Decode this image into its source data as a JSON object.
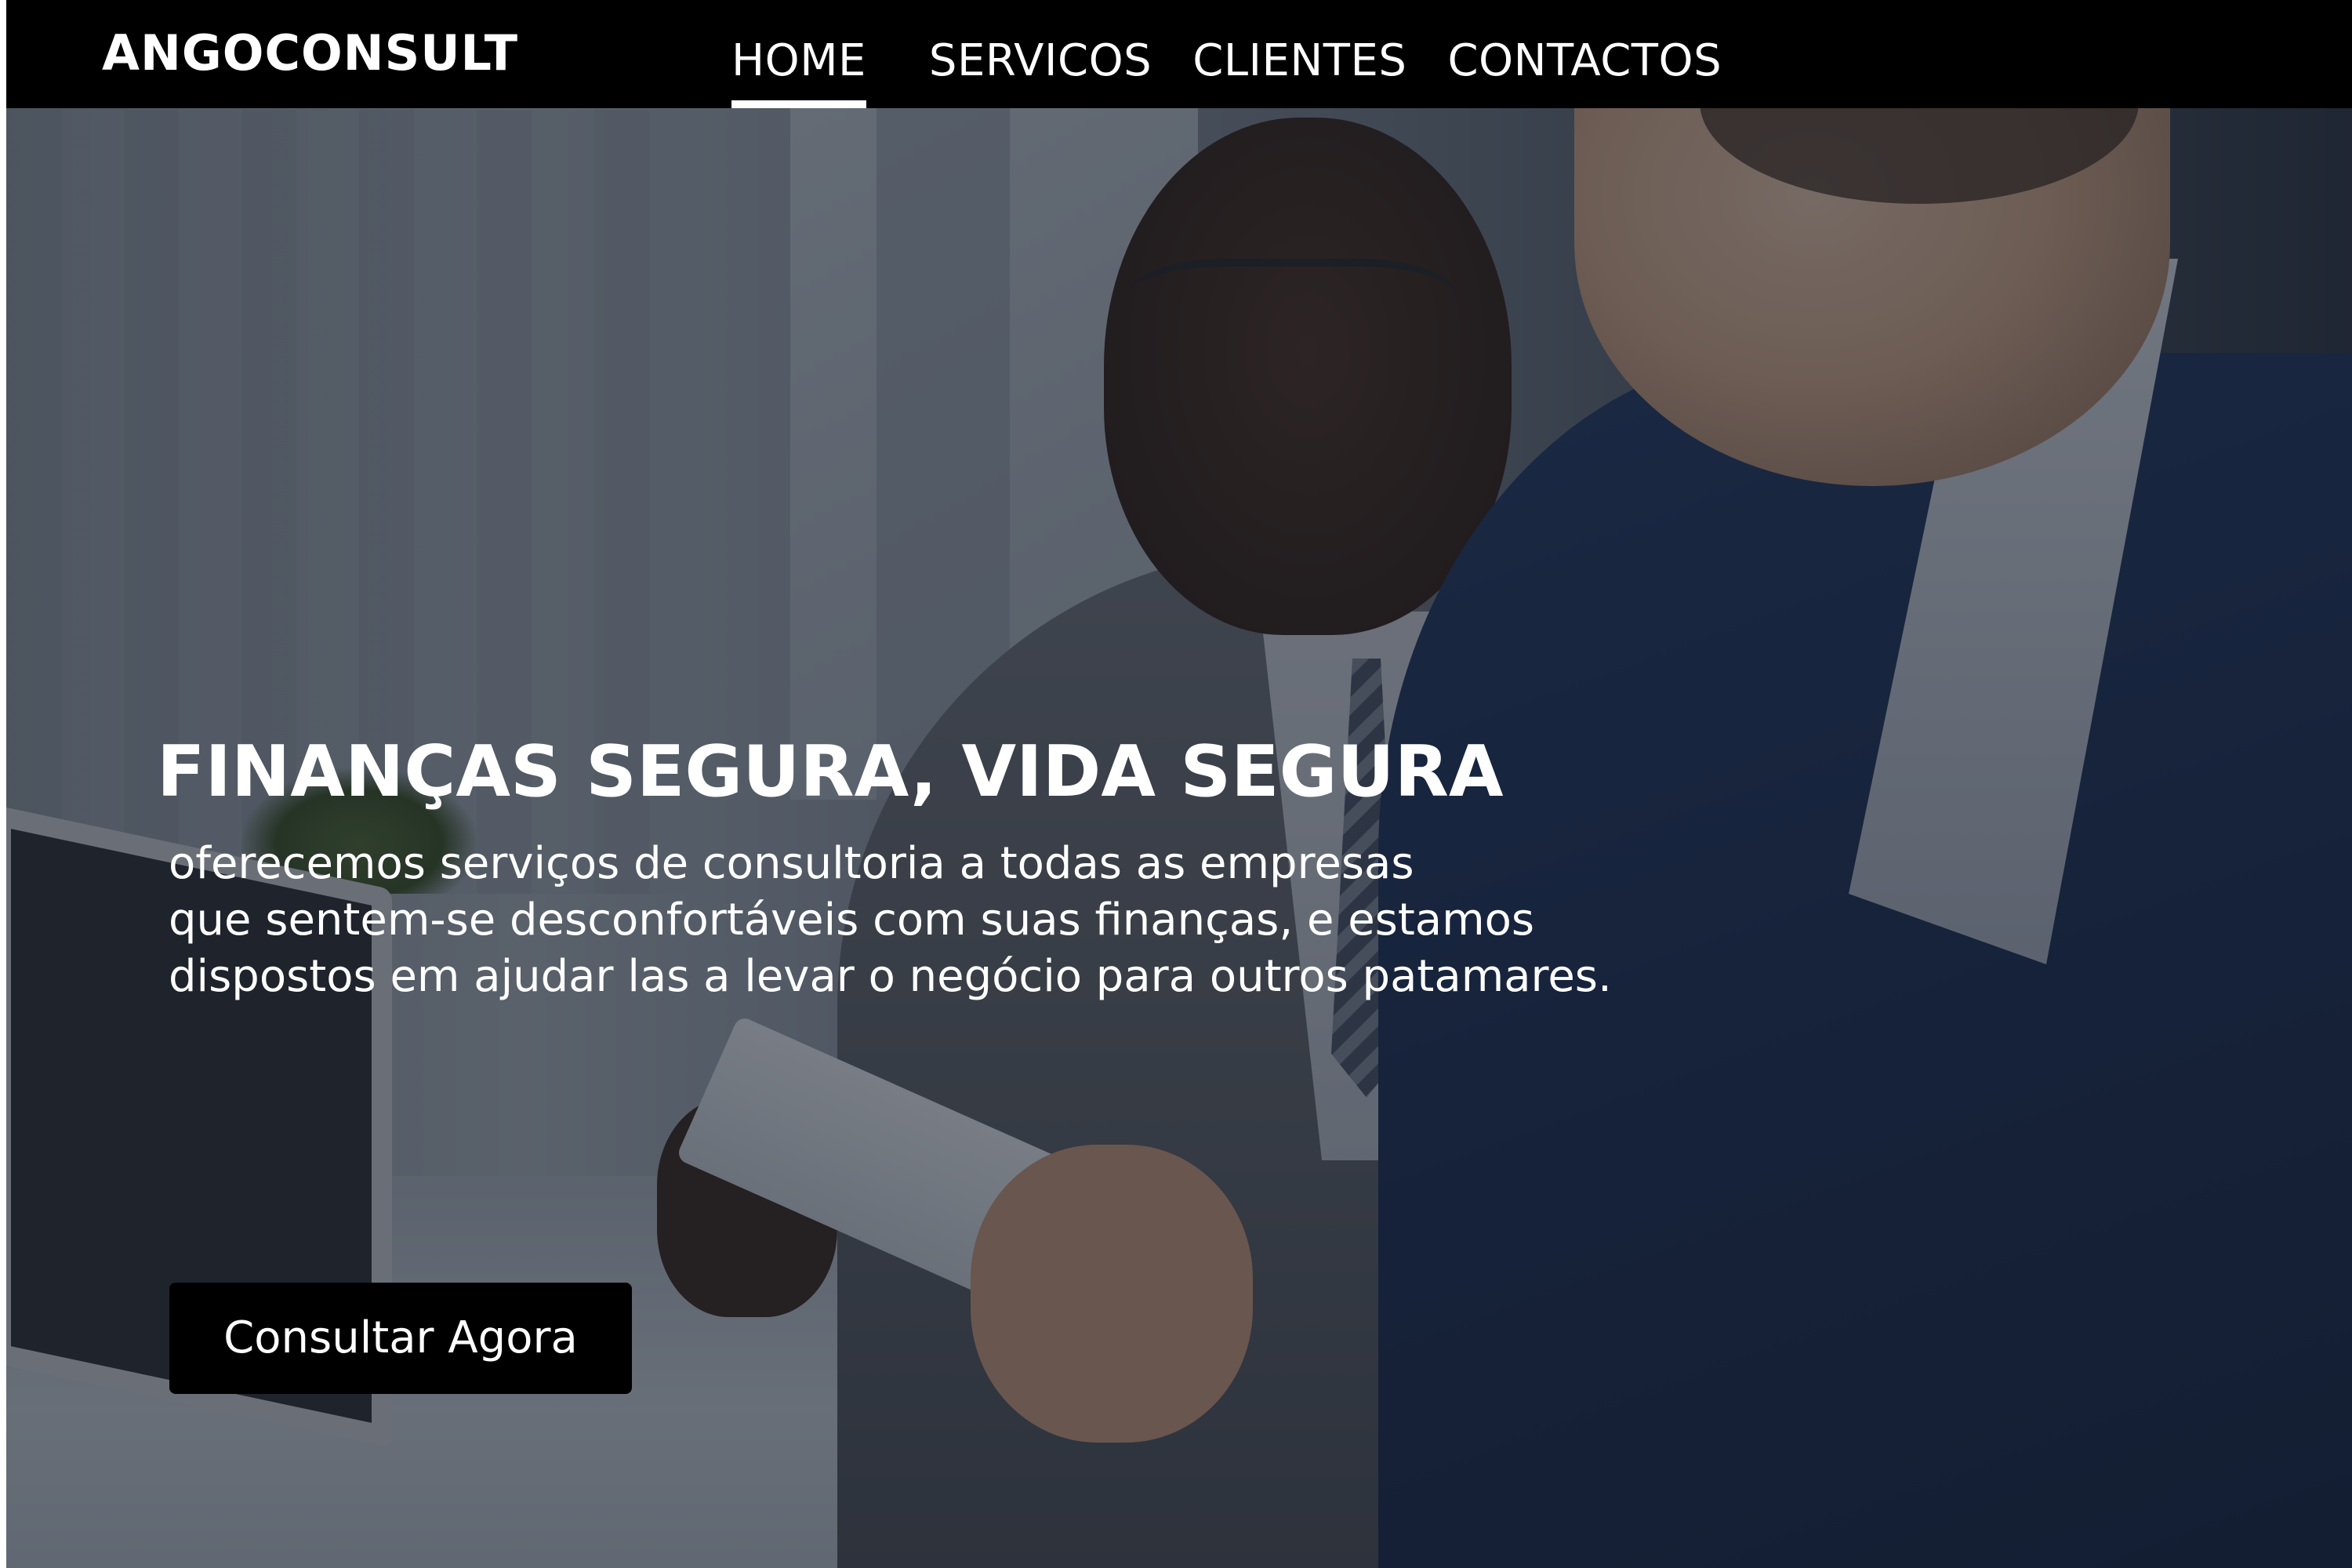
{
  "header": {
    "logo": "ANGOCONSULT",
    "nav": [
      {
        "label": "HOME",
        "active": true
      },
      {
        "label": "SERVICOS",
        "active": false
      },
      {
        "label": "CLIENTES",
        "active": false
      },
      {
        "label": "CONTACTOS",
        "active": false
      }
    ]
  },
  "hero": {
    "headline": "FINANÇAS SEGURA, VIDA SEGURA",
    "description_lines": [
      "oferecemos serviços de consultoria a todas as empresas",
      "que sentem-se desconfortáveis com suas finanças, e estamos",
      "dispostos em ajudar las a levar o  negócio para outros patamares."
    ],
    "cta_label": "Consultar Agora"
  },
  "colors": {
    "navbar_bg": "#000000",
    "nav_text": "#ffffff",
    "active_underline": "#ffffff",
    "cta_bg": "#000000",
    "cta_text": "#ffffff"
  }
}
